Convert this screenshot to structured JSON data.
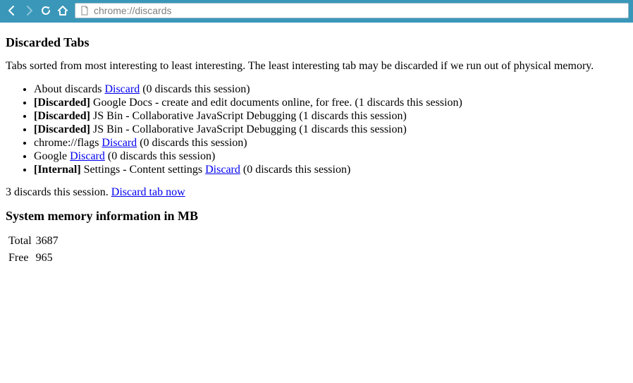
{
  "chrome": {
    "url": "chrome://discards"
  },
  "headings": {
    "discarded": "Discarded Tabs",
    "memory": "System memory information in MB"
  },
  "intro": "Tabs sorted from most interesting to least interesting. The least interesting tab may be discarded if we run out of physical memory.",
  "discard_label": "Discard",
  "tabs": [
    {
      "prefix": "",
      "title": "About discards",
      "has_link": true,
      "count_text": "(0 discards this session)"
    },
    {
      "prefix": "[Discarded]",
      "title": "Google Docs - create and edit documents online, for free.",
      "has_link": false,
      "count_text": "(1 discards this session)"
    },
    {
      "prefix": "[Discarded]",
      "title": "JS Bin - Collaborative JavaScript Debugging",
      "has_link": false,
      "count_text": "(1 discards this session)"
    },
    {
      "prefix": "[Discarded]",
      "title": "JS Bin - Collaborative JavaScript Debugging",
      "has_link": false,
      "count_text": "(1 discards this session)"
    },
    {
      "prefix": "",
      "title": "chrome://flags",
      "has_link": true,
      "count_text": "(0 discards this session)"
    },
    {
      "prefix": "",
      "title": "Google",
      "has_link": true,
      "count_text": "(0 discards this session)"
    },
    {
      "prefix": "[Internal]",
      "title": "Settings - Content settings",
      "has_link": true,
      "count_text": "(0 discards this session)"
    }
  ],
  "summary": {
    "text": "3 discards this session.",
    "link": "Discard tab now"
  },
  "memory": {
    "rows": [
      {
        "label": "Total",
        "value": "3687"
      },
      {
        "label": "Free",
        "value": "965"
      }
    ]
  }
}
